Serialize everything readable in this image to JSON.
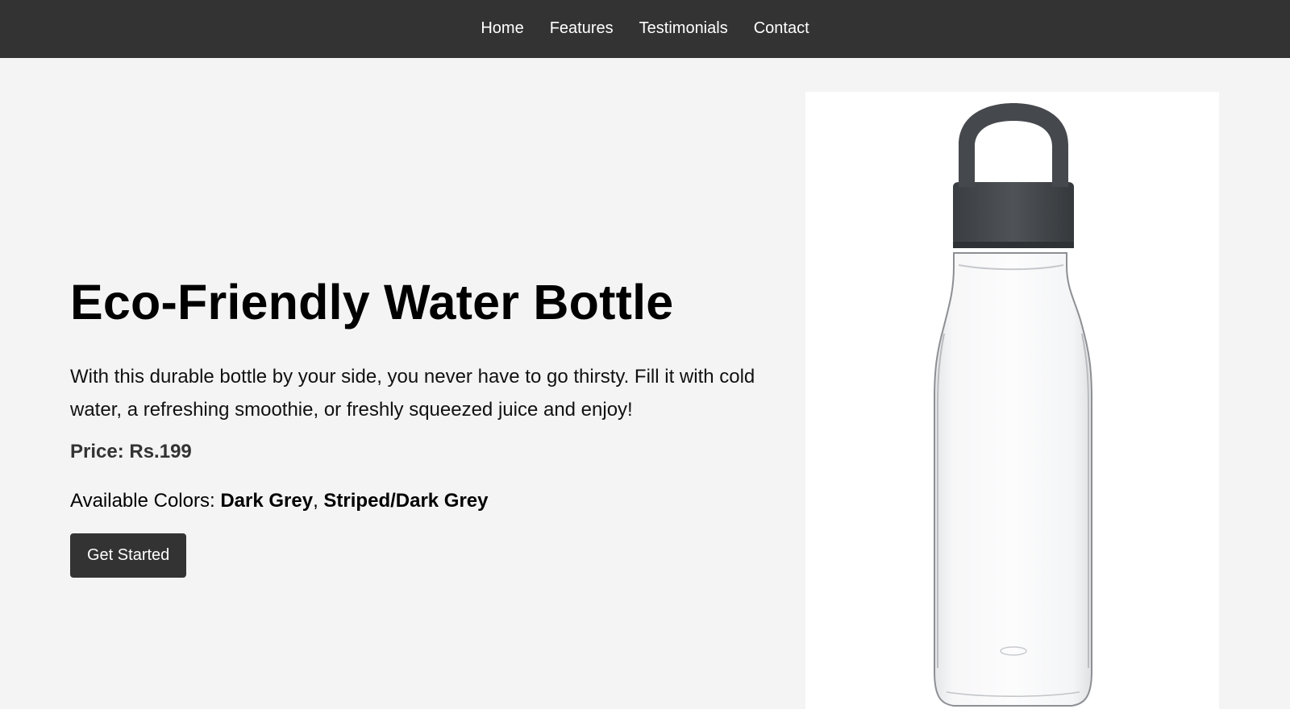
{
  "nav": {
    "items": [
      {
        "label": "Home"
      },
      {
        "label": "Features"
      },
      {
        "label": "Testimonials"
      },
      {
        "label": "Contact"
      }
    ]
  },
  "hero": {
    "title": "Eco-Friendly Water Bottle",
    "description": "With this durable bottle by your side, you never have to go thirsty. Fill it with cold water, a refreshing smoothie, or freshly squeezed juice and enjoy!",
    "price": "Price: Rs.199",
    "colors_prefix": "Available Colors: ",
    "colors": [
      "Dark Grey",
      "Striped/Dark Grey"
    ],
    "colors_separator": ", ",
    "cta_label": "Get Started"
  },
  "product_image": {
    "icon": "water-bottle-image"
  },
  "theme": {
    "nav_bg": "#333333",
    "page_bg": "#f4f4f4",
    "button_bg": "#333333",
    "cap_color": "#46494d"
  }
}
